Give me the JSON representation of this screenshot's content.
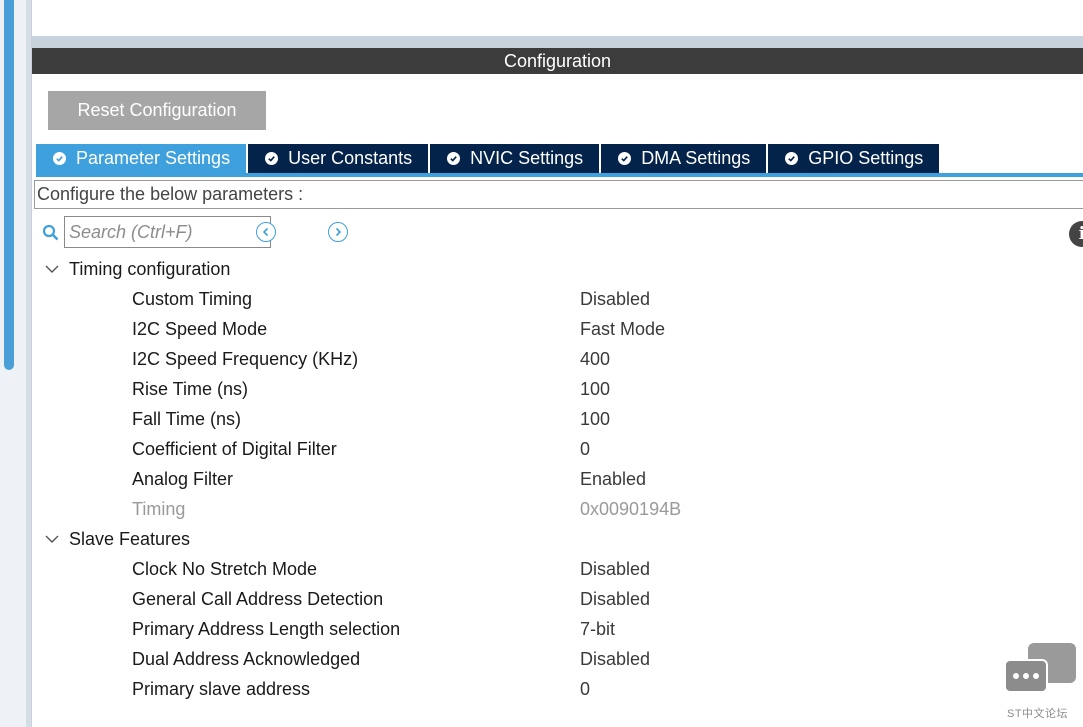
{
  "panel": {
    "title": "Configuration"
  },
  "toolbar": {
    "reset_label": "Reset Configuration"
  },
  "tabs": [
    {
      "label": "Parameter Settings",
      "active": true
    },
    {
      "label": "User Constants",
      "active": false
    },
    {
      "label": "NVIC Settings",
      "active": false
    },
    {
      "label": "DMA Settings",
      "active": false
    },
    {
      "label": "GPIO Settings",
      "active": false
    }
  ],
  "instruction": "Configure the below parameters :",
  "search": {
    "placeholder": "Search (Ctrl+F)"
  },
  "groups": {
    "timing": {
      "title": "Timing configuration",
      "params": [
        {
          "name": "Custom Timing",
          "value": "Disabled"
        },
        {
          "name": "I2C Speed Mode",
          "value": "Fast Mode"
        },
        {
          "name": "I2C Speed Frequency (KHz)",
          "value": "400"
        },
        {
          "name": "Rise Time (ns)",
          "value": "100"
        },
        {
          "name": "Fall Time (ns)",
          "value": "100"
        },
        {
          "name": "Coefficient of Digital Filter",
          "value": "0"
        },
        {
          "name": "Analog Filter",
          "value": "Enabled"
        },
        {
          "name": "Timing",
          "value": "0x0090194B",
          "disabled": true
        }
      ]
    },
    "slave": {
      "title": "Slave Features",
      "params": [
        {
          "name": "Clock No Stretch Mode",
          "value": "Disabled"
        },
        {
          "name": "General Call Address Detection",
          "value": "Disabled"
        },
        {
          "name": "Primary Address Length selection",
          "value": "7-bit"
        },
        {
          "name": "Dual Address Acknowledged",
          "value": "Disabled"
        },
        {
          "name": "Primary slave address",
          "value": "0"
        }
      ]
    }
  },
  "watermark": {
    "text": "ST中文论坛"
  },
  "colors": {
    "header_bg": "#3c3c3c",
    "tab_active": "#3ea0dc",
    "tab_inactive": "#03234b",
    "button_bg": "#a6a6a6",
    "disabled_text": "#9a9a9a"
  }
}
